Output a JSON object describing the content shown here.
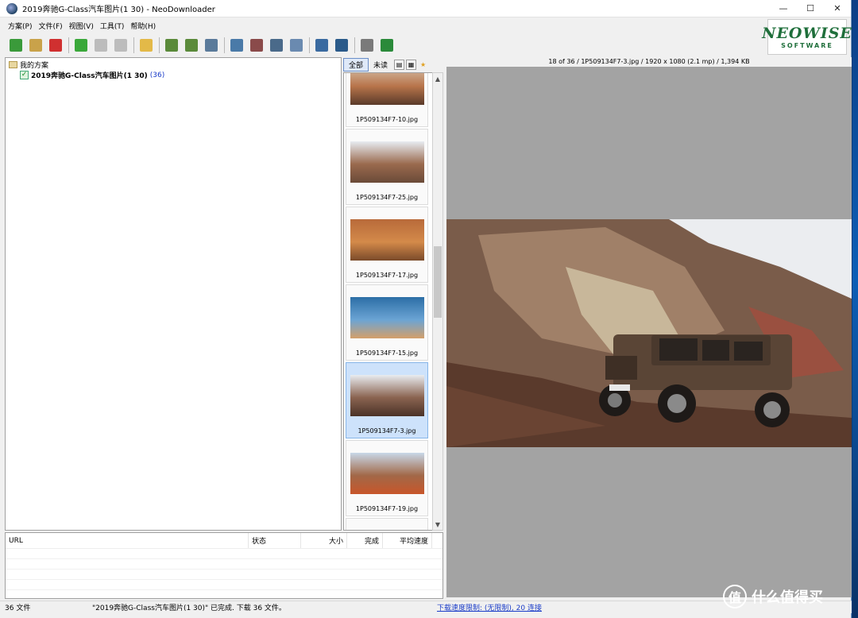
{
  "window": {
    "title": "2019奔驰G-Class汽车图片(1 30) - NeoDownloader"
  },
  "titlebar_buttons": {
    "minimize": "—",
    "maximize": "☐",
    "close": "✕"
  },
  "menu": [
    "方案(P)",
    "文件(F)",
    "视图(V)",
    "工具(T)",
    "帮助(H)"
  ],
  "logo": {
    "line1": "NEOWISE",
    "line2": "SOFTWARE"
  },
  "toolbar": {
    "groups": [
      [
        {
          "name": "new-project-icon",
          "color": "#3a9a3a"
        },
        {
          "name": "edit-project-icon",
          "color": "#c9a24a"
        },
        {
          "name": "delete-project-icon",
          "color": "#d03030"
        }
      ],
      [
        {
          "name": "start-icon",
          "color": "#3aa83a"
        },
        {
          "name": "pause-icon",
          "color": "#bcbcbc"
        },
        {
          "name": "stop-icon",
          "color": "#bcbcbc"
        }
      ],
      [
        {
          "name": "open-folder-icon",
          "color": "#e3b948"
        }
      ],
      [
        {
          "name": "import-icon",
          "color": "#5a8a3a"
        },
        {
          "name": "export-icon",
          "color": "#5a8a3a"
        },
        {
          "name": "download-images-icon",
          "color": "#5a7a9a"
        }
      ],
      [
        {
          "name": "image-view-icon",
          "color": "#4a7aa8"
        },
        {
          "name": "remove-image-icon",
          "color": "#8a4a4a"
        },
        {
          "name": "save-image-icon",
          "color": "#4a6a8a"
        },
        {
          "name": "mail-icon",
          "color": "#6a8ab0"
        }
      ],
      [
        {
          "name": "window-icon",
          "color": "#3a6aa0"
        },
        {
          "name": "fullscreen-icon",
          "color": "#2a5a8a"
        }
      ],
      [
        {
          "name": "tools-icon",
          "color": "#7a7a7a"
        },
        {
          "name": "web-icon",
          "color": "#2a8a3a"
        }
      ]
    ]
  },
  "tree": {
    "root": "我的方案",
    "project": {
      "label": "2019奔驰G-Class汽车图片(1 30)",
      "count": "(36)"
    }
  },
  "thumb_tabs": {
    "all": "全部",
    "unread": "未读"
  },
  "thumbnails": [
    {
      "name": "1P509134F7-10.jpg",
      "selected": false,
      "colors": [
        "#d8c8b4",
        "#b8744a",
        "#5a3a2a"
      ]
    },
    {
      "name": "1P509134F7-25.jpg",
      "selected": false,
      "colors": [
        "#e7ecf1",
        "#9a6a4e",
        "#6a4a38"
      ]
    },
    {
      "name": "1P509134F7-17.jpg",
      "selected": false,
      "colors": [
        "#b86a3a",
        "#d48a4a",
        "#7a4a2a"
      ]
    },
    {
      "name": "1P509134F7-15.jpg",
      "selected": false,
      "colors": [
        "#2c6ea6",
        "#6ba4d4",
        "#d4a06a"
      ]
    },
    {
      "name": "1P509134F7-3.jpg",
      "selected": true,
      "colors": [
        "#e8ecf0",
        "#8a6350",
        "#4a3328"
      ]
    },
    {
      "name": "1P509134F7-19.jpg",
      "selected": false,
      "colors": [
        "#c8d8e8",
        "#a26848",
        "#c8562a"
      ]
    },
    {
      "name": "",
      "selected": false,
      "colors": [
        "#c8d0d8",
        "#b0724a",
        "#7a4a2a"
      ]
    }
  ],
  "viewer": {
    "info": "18 of 36 / 1P509134F7-3.jpg / 1920 x 1080 (2.1 mp) / 1,394 KB"
  },
  "download_columns": [
    "URL",
    "状态",
    "大小",
    "完成",
    "平均速度"
  ],
  "status": {
    "files": "36 文件",
    "message": "\"2019奔驰G-Class汽车图片(1 30)\" 已完成. 下载 36 文件。",
    "speed": "下载速度限制: (无限制), 20 连接"
  },
  "watermark": {
    "icon": "值",
    "text": "什么值得买"
  }
}
